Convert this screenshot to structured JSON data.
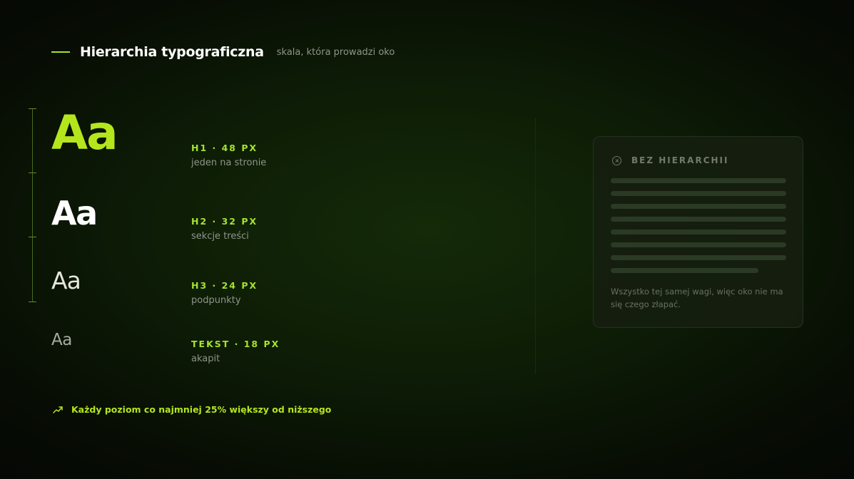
{
  "header": {
    "title": "Hierarchia typograficzna",
    "subtitle": "skala, która prowadzi oko"
  },
  "samples": [
    {
      "glyph": "Aa",
      "label": "H1 · 48 PX",
      "desc": "jeden na stronie"
    },
    {
      "glyph": "Aa",
      "label": "H2 · 32 PX",
      "desc": "sekcje treści"
    },
    {
      "glyph": "Aa",
      "label": "H3 · 24 PX",
      "desc": "podpunkty"
    },
    {
      "glyph": "Aa",
      "label": "TEKST · 18 PX",
      "desc": "akapit"
    }
  ],
  "card": {
    "icon": "circle-x-icon",
    "title": "BEZ HIERARCHII",
    "note": "Wszystko tej samej wagi, więc oko nie ma się czego złapać."
  },
  "footer": {
    "icon": "trending-up-arrow-icon",
    "text": "Każdy poziom co najmniej 25% większy od niższego"
  },
  "colors": {
    "accent": "#b5e61d",
    "background": "#0d1c06"
  }
}
